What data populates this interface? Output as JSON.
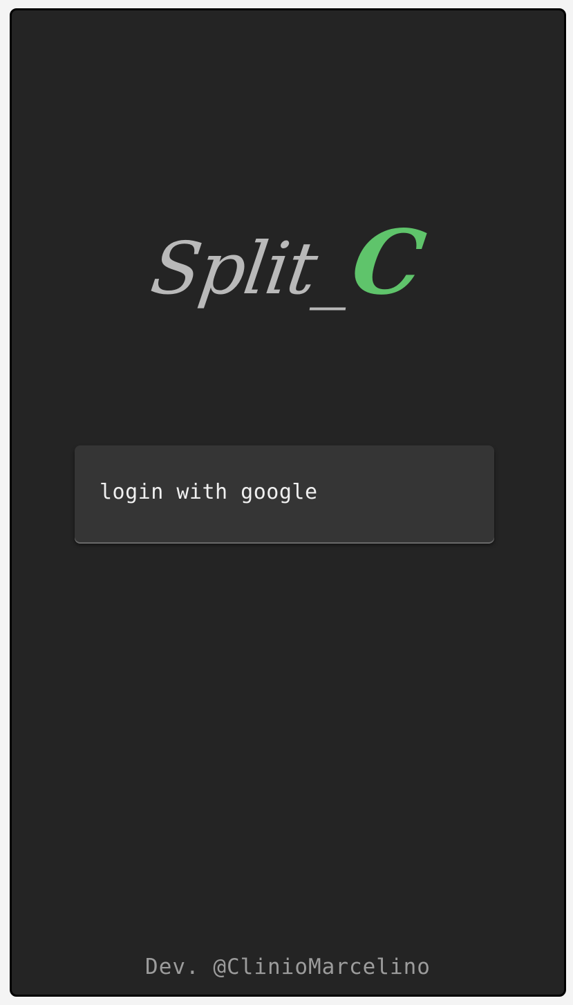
{
  "app": {
    "logo_text": "Split_",
    "logo_accent": "C"
  },
  "login": {
    "button_label": "login with google"
  },
  "footer": {
    "credit": "Dev. @ClinioMarcelino"
  },
  "colors": {
    "background": "#242424",
    "logo_gray": "#b9b9b9",
    "logo_accent_green": "#5fc46b",
    "button_bg": "#353535",
    "button_text": "#f0f0f0",
    "footer_text": "#9c9c9c"
  }
}
